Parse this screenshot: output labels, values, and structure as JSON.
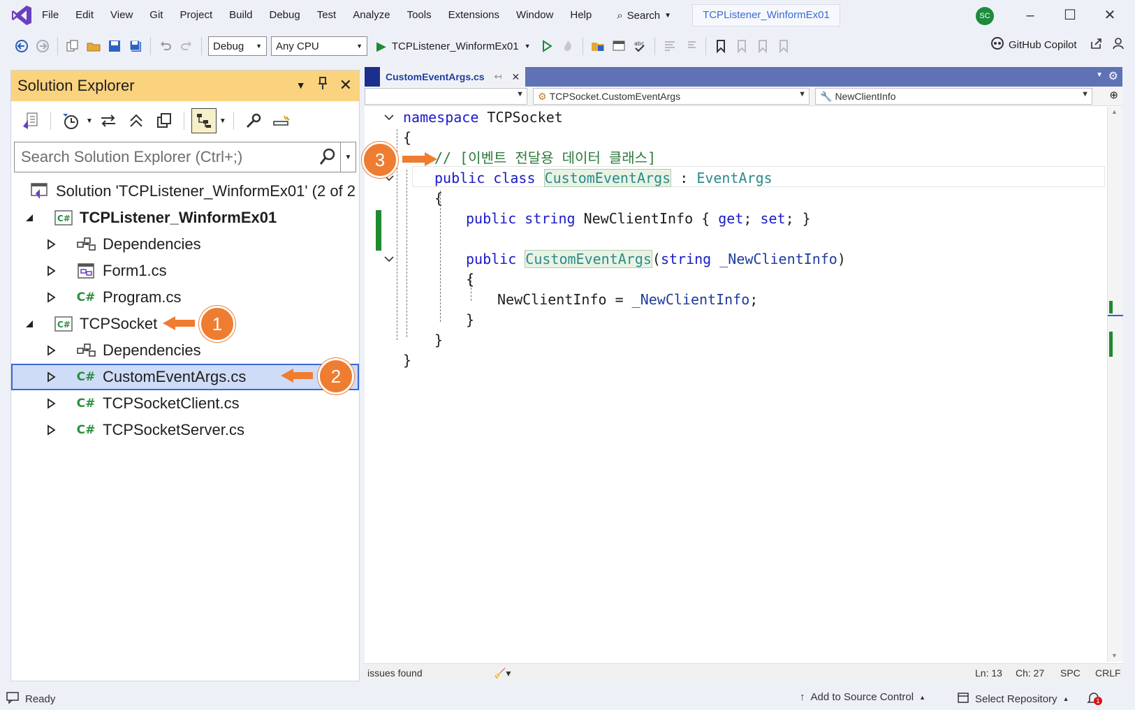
{
  "menubar": {
    "items": [
      "File",
      "Edit",
      "View",
      "Git",
      "Project",
      "Build",
      "Debug",
      "Test",
      "Analyze",
      "Tools",
      "Extensions",
      "Window",
      "Help"
    ],
    "search_label": "Search",
    "window_title": "TCPListener_WinformEx01",
    "avatar_initials": "SC"
  },
  "toolbar": {
    "configuration": "Debug",
    "platform": "Any CPU",
    "run_target": "TCPListener_WinformEx01",
    "copilot_label": "GitHub Copilot"
  },
  "solution_explorer": {
    "title": "Solution Explorer",
    "search_placeholder": "Search Solution Explorer (Ctrl+;)",
    "tree": {
      "solution": "Solution 'TCPListener_WinformEx01' (2 of 2",
      "project1": "TCPListener_WinformEx01",
      "p1_dependencies": "Dependencies",
      "p1_form1": "Form1.cs",
      "p1_program": "Program.cs",
      "project2": "TCPSocket",
      "p2_dependencies": "Dependencies",
      "p2_customeventargs": "CustomEventArgs.cs",
      "p2_client": "TCPSocketClient.cs",
      "p2_server": "TCPSocketServer.cs"
    }
  },
  "editor": {
    "tab_label": "CustomEventArgs.cs",
    "nav_type": "TCPSocket.CustomEventArgs",
    "nav_member": "NewClientInfo",
    "code": {
      "kw_namespace": "namespace",
      "ns_name": " TCPSocket",
      "brace_open": "{",
      "brace_close": "}",
      "comment": "// [이벤트 전달용 데이터 클래스]",
      "kw_public": "public",
      "kw_class": "class",
      "class_name": "CustomEventArgs",
      "colon": " : ",
      "base_type": "EventArgs",
      "kw_string": "string",
      "prop_name": " NewClientInfo { ",
      "kw_get": "get",
      "semi_sp": "; ",
      "kw_set": "set",
      "prop_tail": "; }",
      "ctor_open": "(",
      "param_name": " _NewClientInfo",
      "ctor_close": ")",
      "assign_lhs": "NewClientInfo = ",
      "assign_rhs": "_NewClientInfo",
      "semi": ";"
    },
    "status": {
      "issues": "issues found",
      "line": "Ln: 13",
      "char": "Ch: 27",
      "spacing": "SPC",
      "line_ending": "CRLF"
    }
  },
  "statusbar": {
    "ready": "Ready",
    "source_control": "Add to Source Control",
    "repository": "Select Repository",
    "notifications": "1"
  },
  "callouts": [
    "1",
    "2",
    "3"
  ],
  "colors": {
    "accent": "#ee7d31",
    "se_title": "#fbd27e",
    "selection": "#cfdcf7",
    "keyword": "#1a1ac8",
    "type": "#2b8a8a",
    "comment": "#2d7a3a",
    "change_bar": "#1f8a2e"
  }
}
